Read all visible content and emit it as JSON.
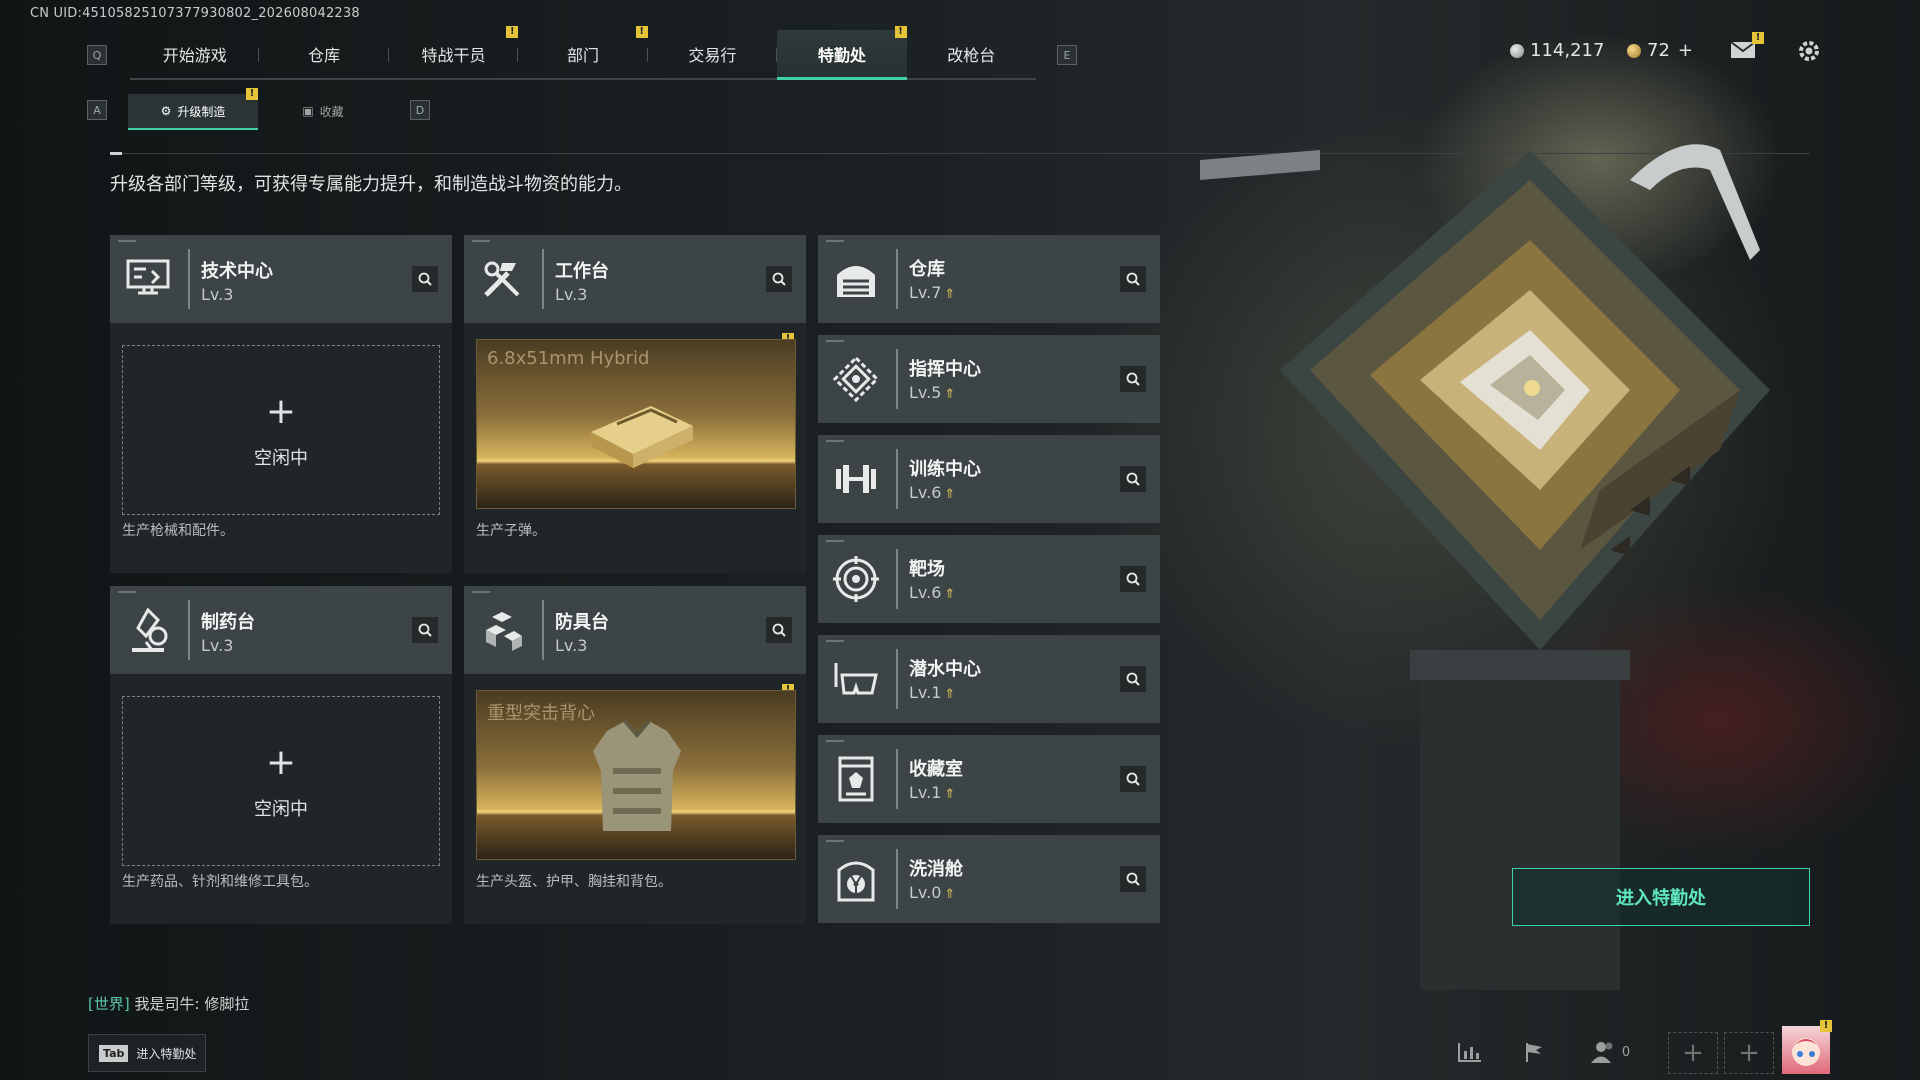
{
  "uid": "CN UID:4510582510737793080​2_202608042238",
  "nav": {
    "left_key": "Q",
    "right_key": "E",
    "tabs": [
      {
        "label": "开始游戏"
      },
      {
        "label": "仓库"
      },
      {
        "label": "特战干员"
      },
      {
        "label": "部门"
      },
      {
        "label": "交易行"
      },
      {
        "label": "特勤处",
        "active": true
      },
      {
        "label": "改枪台"
      }
    ],
    "badge_mark": "!"
  },
  "currency": {
    "silver": "114,217",
    "gold": "72",
    "gold_add": "+"
  },
  "subtabs": {
    "left_key": "A",
    "right_key": "D",
    "items": [
      {
        "label": "升级制造",
        "active": true
      },
      {
        "label": "收藏"
      }
    ]
  },
  "description": "升级各部门等级，可获得专属能力提升，和制造战斗物资的能力。",
  "workshops": [
    {
      "name": "技术中心",
      "level": "Lv.3",
      "icon": "tech-center-icon",
      "state": "idle",
      "idle_plus": "+",
      "idle_text": "空闲中",
      "footer": "生产枪械和配件。"
    },
    {
      "name": "工作台",
      "level": "Lv.3",
      "icon": "workbench-icon",
      "state": "producing",
      "product": "6.8x51mm Hybrid",
      "footer": "生产子弹。"
    },
    {
      "name": "制药台",
      "level": "Lv.3",
      "icon": "pharmacy-icon",
      "state": "idle",
      "idle_plus": "+",
      "idle_text": "空闲中",
      "footer": "生产药品、针剂和维修工具包。"
    },
    {
      "name": "防具台",
      "level": "Lv.3",
      "icon": "armor-bench-icon",
      "state": "producing",
      "product": "重型突击背心",
      "footer": "生产头盔、护甲、胸挂和背包。"
    }
  ],
  "facilities": [
    {
      "name": "仓库",
      "level": "Lv.7",
      "icon": "warehouse-icon"
    },
    {
      "name": "指挥中心",
      "level": "Lv.5",
      "icon": "command-center-icon"
    },
    {
      "name": "训练中心",
      "level": "Lv.6",
      "icon": "training-center-icon"
    },
    {
      "name": "靶场",
      "level": "Lv.6",
      "icon": "shooting-range-icon"
    },
    {
      "name": "潜水中心",
      "level": "Lv.1",
      "icon": "diving-center-icon"
    },
    {
      "name": "收藏室",
      "level": "Lv.1",
      "icon": "collection-room-icon"
    },
    {
      "name": "洗消舱",
      "level": "Lv.0",
      "icon": "decontamination-icon"
    }
  ],
  "enter_button": "进入特勤处",
  "chat": {
    "channel": "[世界]",
    "message": "我是司牛: 修脚拉"
  },
  "tab_hint": {
    "key": "Tab",
    "label": "进入特勤处"
  },
  "social": {
    "friends_count": "0"
  },
  "colors": {
    "accent": "#3fd0a8",
    "badge": "#e5c43a",
    "upgrade_arrow": "#e2c15a",
    "production_gold": "#d6b35c"
  }
}
